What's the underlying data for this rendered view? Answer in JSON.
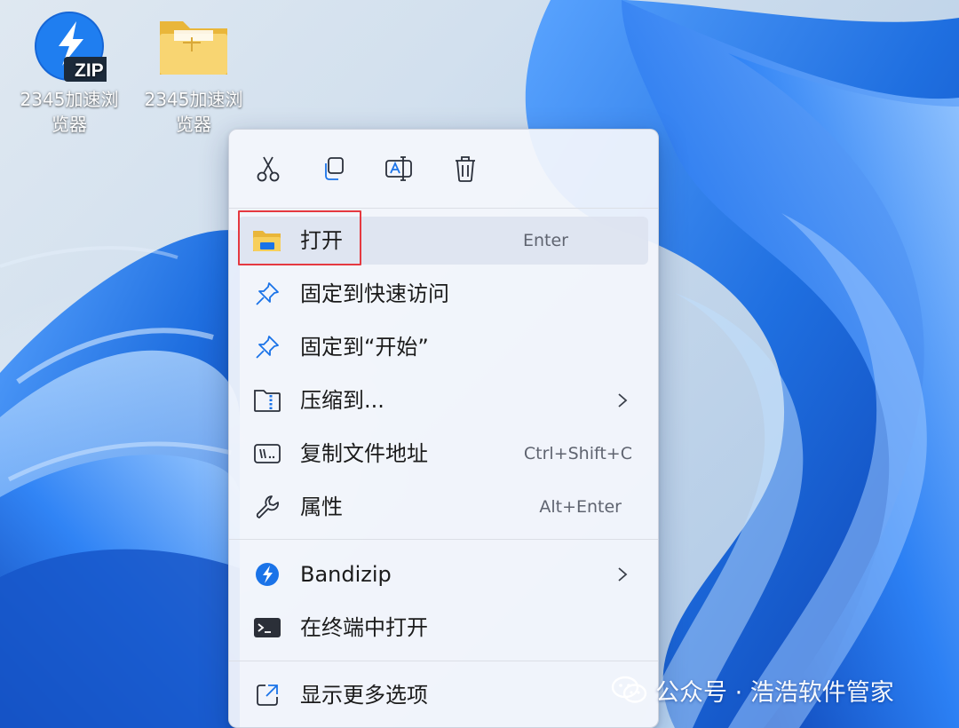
{
  "desktop": {
    "icons": [
      {
        "line1": "2345加速浏",
        "line2": "览器",
        "icon": "zip-archive-icon"
      },
      {
        "line1": "2345加速浏",
        "line2": "览器",
        "icon": "folder-icon"
      }
    ]
  },
  "context_menu": {
    "toolbar": {
      "cut_icon": "scissors-icon",
      "copy_icon": "copy-icon",
      "rename_icon": "rename-icon",
      "delete_icon": "trash-icon"
    },
    "items": [
      {
        "label": "打开",
        "shortcut": "Enter",
        "icon": "folder-open-icon",
        "highlighted": true
      },
      {
        "label": "固定到快速访问",
        "shortcut": "",
        "icon": "pin-icon"
      },
      {
        "label": "固定到“开始”",
        "shortcut": "",
        "icon": "pin-icon"
      },
      {
        "label": "压缩到...",
        "shortcut": "",
        "icon": "compress-folder-icon",
        "submenu": true
      },
      {
        "label": "复制文件地址",
        "shortcut": "Ctrl+Shift+C",
        "icon": "copy-path-icon"
      },
      {
        "label": "属性",
        "shortcut": "Alt+Enter",
        "icon": "wrench-icon"
      },
      {
        "label": "Bandizip",
        "shortcut": "",
        "icon": "bandizip-icon",
        "submenu": true
      },
      {
        "label": "在终端中打开",
        "shortcut": "",
        "icon": "terminal-icon"
      },
      {
        "label": "显示更多选项",
        "shortcut": "",
        "icon": "more-options-icon"
      }
    ]
  },
  "annotation": {
    "highlight_color": "#e53940"
  },
  "watermark": {
    "text": "公众号 · 浩浩软件管家"
  },
  "colors": {
    "accent": "#1a73e8",
    "menu_bg": "#f4f6fc",
    "wallpaper_blue": "#1f6fe0"
  }
}
